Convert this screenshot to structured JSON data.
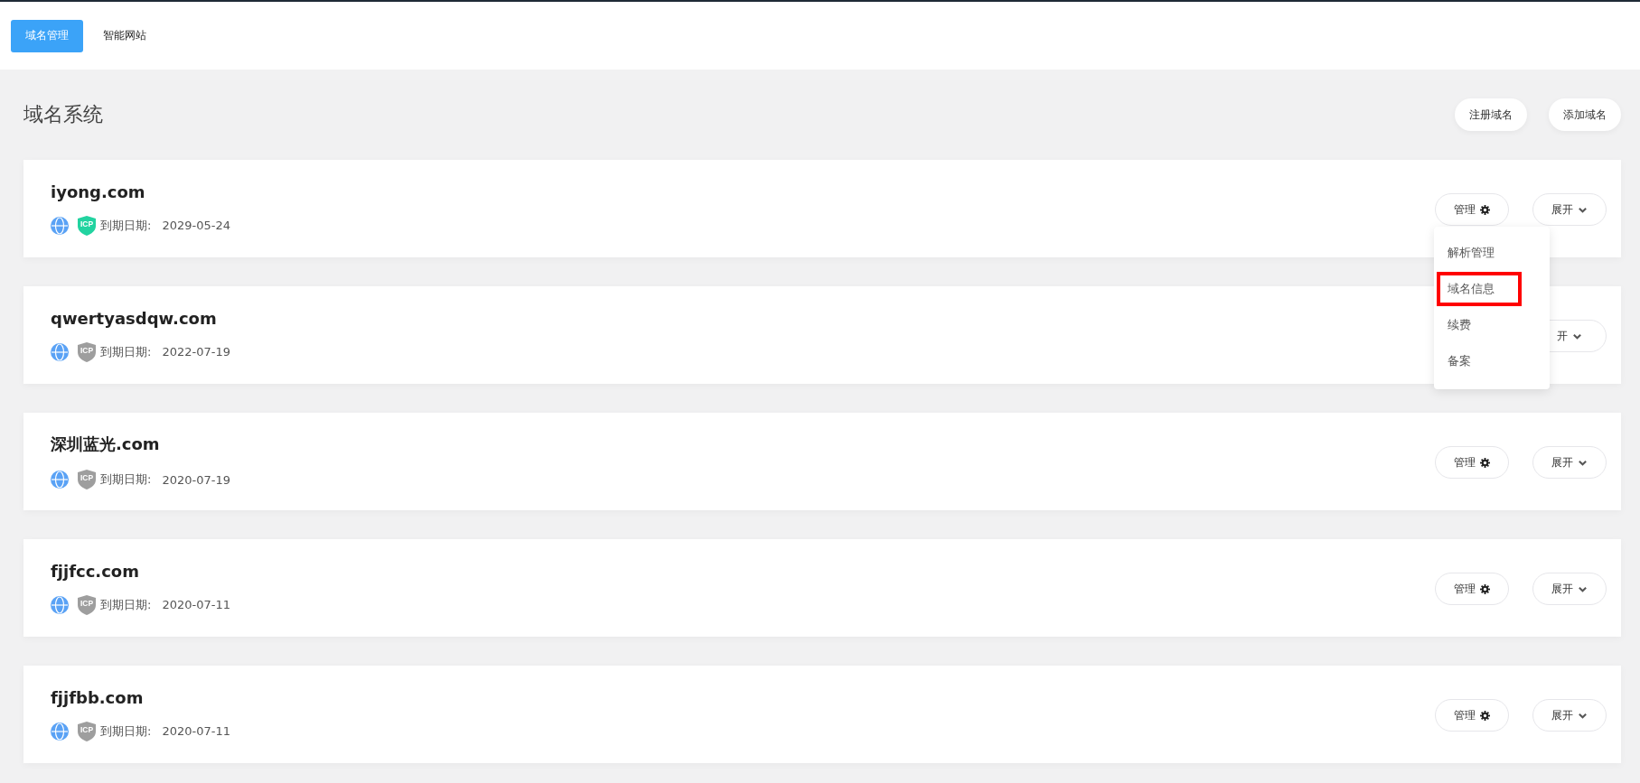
{
  "tabs": [
    {
      "label": "域名管理",
      "selected": true
    },
    {
      "label": "智能网站",
      "selected": false
    }
  ],
  "page_title": "域名系统",
  "header_buttons": [
    "注册域名",
    "添加域名"
  ],
  "domains": [
    {
      "name": "iyong.com",
      "icp_label": "ICP",
      "icp_filed": true,
      "expiry_label": "到期日期:",
      "expiry": "2029-05-24",
      "manage_label": "管理",
      "expand_label": "展开",
      "menu_open": true
    },
    {
      "name": "qwertyasdqw.com",
      "icp_label": "ICP",
      "icp_filed": false,
      "expiry_label": "到期日期:",
      "expiry": "2022-07-19",
      "expand_label": "开",
      "menu_open": false
    },
    {
      "name": "深圳蓝光.com",
      "icp_label": "ICP",
      "icp_filed": false,
      "expiry_label": "到期日期:",
      "expiry": "2020-07-19",
      "manage_label": "管理",
      "expand_label": "展开",
      "menu_open": false
    },
    {
      "name": "fjjfcc.com",
      "icp_label": "ICP",
      "icp_filed": false,
      "expiry_label": "到期日期:",
      "expiry": "2020-07-11",
      "manage_label": "管理",
      "expand_label": "展开",
      "menu_open": false
    },
    {
      "name": "fjjfbb.com",
      "icp_label": "ICP",
      "icp_filed": false,
      "expiry_label": "到期日期:",
      "expiry": "2020-07-11",
      "manage_label": "管理",
      "expand_label": "展开",
      "menu_open": false
    }
  ],
  "manage_menu": [
    {
      "label": "解析管理",
      "highlighted": false
    },
    {
      "label": "域名信息",
      "highlighted": true
    },
    {
      "label": "续费",
      "highlighted": false
    },
    {
      "label": "备案",
      "highlighted": false
    }
  ]
}
